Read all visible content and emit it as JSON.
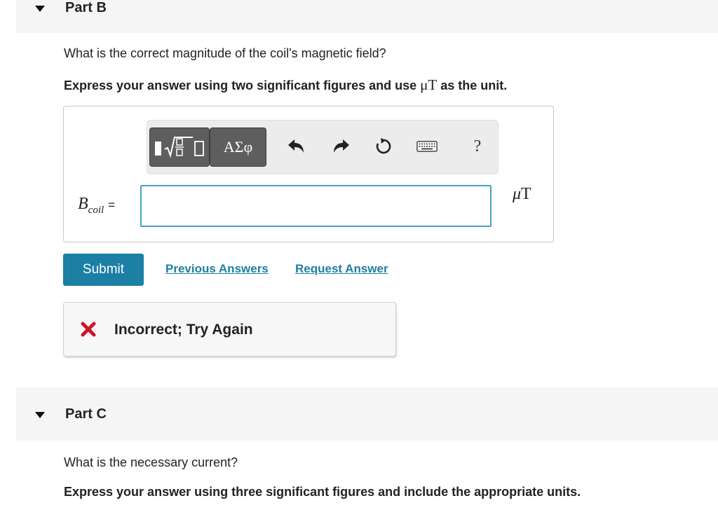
{
  "partB": {
    "title": "Part B",
    "question": "What is the correct magnitude of the coil's magnetic field?",
    "instruction_prefix": "Express your answer using two significant figures and use ",
    "instruction_unit": "μT",
    "instruction_suffix": " as the unit.",
    "toolbar": {
      "greek_label": "ΑΣφ",
      "help_label": "?",
      "icons": [
        "templates-icon",
        "undo-icon",
        "redo-icon",
        "reset-icon",
        "keyboard-icon",
        "help-icon"
      ]
    },
    "variable": {
      "base": "B",
      "subscript": "coil",
      "equals": "="
    },
    "answer_value": "",
    "unit": {
      "prefix": "μ",
      "symbol": "T"
    },
    "submit_label": "Submit",
    "previous_answers_label": "Previous Answers",
    "request_answer_label": "Request Answer",
    "feedback": {
      "text": "Incorrect; Try Again",
      "status_color": "#d0112b"
    }
  },
  "partC": {
    "title": "Part C",
    "question": "What is the necessary current?",
    "instruction": "Express your answer using three significant figures and include the appropriate units."
  },
  "colors": {
    "accent": "#1c7fa4",
    "input_border": "#4aa0c6",
    "header_bg": "#f5f5f5"
  }
}
